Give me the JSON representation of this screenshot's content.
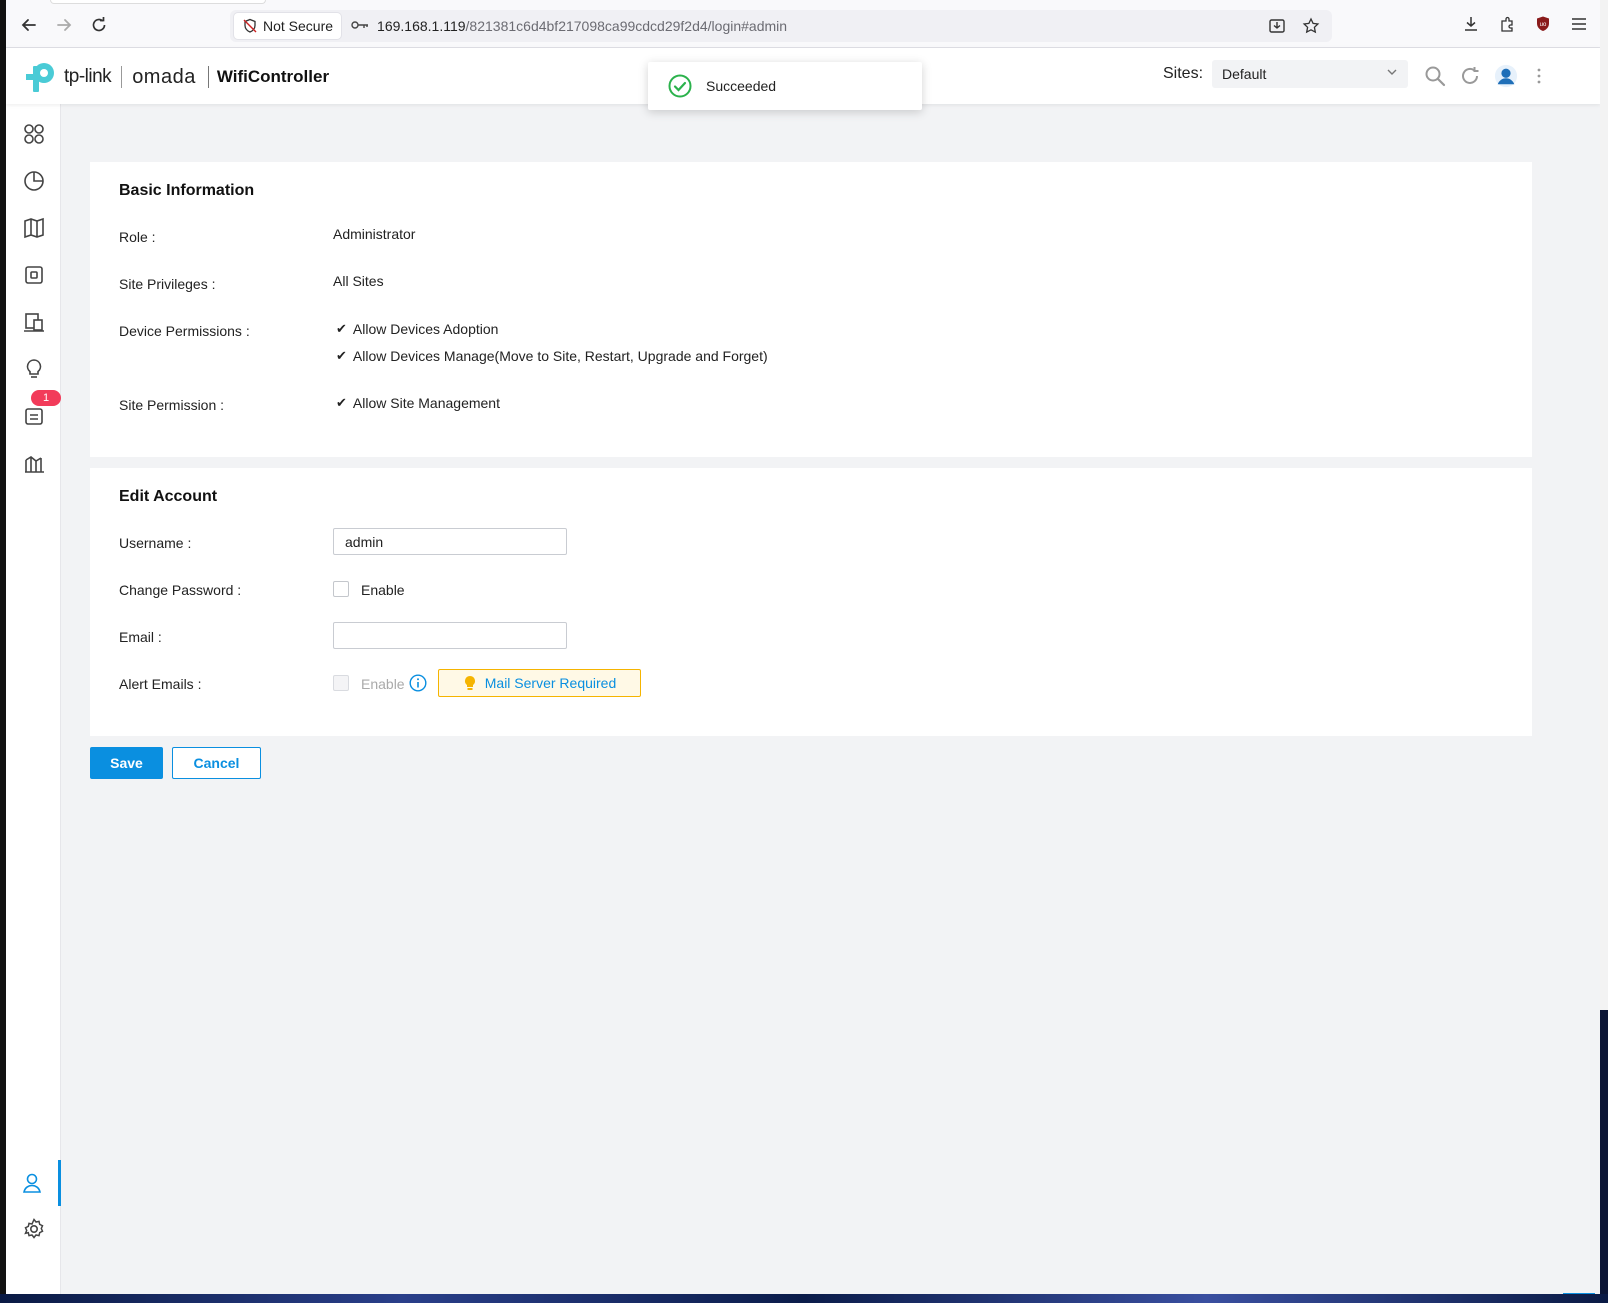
{
  "browser": {
    "security_label": "Not Secure",
    "url_host": "169.168.1.119",
    "url_path": "/821381c6d4bf217098ca99cdcd29f2d4/login#admin"
  },
  "header": {
    "brand_tp": "tp-link",
    "brand_omada": "omada",
    "product": "WifiController",
    "sites_label": "Sites:",
    "sites_selected": "Default"
  },
  "toast": {
    "message": "Succeeded"
  },
  "sidebar": {
    "items": [
      {
        "name": "dashboard-icon"
      },
      {
        "name": "statistics-icon"
      },
      {
        "name": "map-icon"
      },
      {
        "name": "devices-icon"
      },
      {
        "name": "clients-icon"
      },
      {
        "name": "insight-icon"
      },
      {
        "name": "log-icon",
        "badge": "1"
      },
      {
        "name": "reports-icon"
      }
    ],
    "bottom": [
      {
        "name": "account-icon",
        "active": true
      },
      {
        "name": "settings-icon"
      }
    ]
  },
  "basic_info": {
    "title": "Basic Information",
    "role_label": "Role",
    "role_value": "Administrator",
    "site_priv_label": "Site Privileges",
    "site_priv_value": "All Sites",
    "device_perm_label": "Device Permissions",
    "device_perm_1": "Allow Devices Adoption",
    "device_perm_2": "Allow Devices Manage(Move to Site, Restart, Upgrade and Forget)",
    "site_perm_label": "Site Permission",
    "site_perm_1": "Allow Site Management"
  },
  "edit_account": {
    "title": "Edit Account",
    "username_label": "Username",
    "username_value": "admin",
    "change_pw_label": "Change Password",
    "change_pw_option": "Enable",
    "email_label": "Email",
    "email_value": "",
    "alert_label": "Alert Emails",
    "alert_option": "Enable",
    "mail_server_required": "Mail Server Required"
  },
  "actions": {
    "save": "Save",
    "cancel": "Cancel"
  },
  "colors": {
    "accent": "#0a8fe0",
    "success": "#2bb24c",
    "badge": "#f23b5a",
    "warning": "#f5b400"
  }
}
